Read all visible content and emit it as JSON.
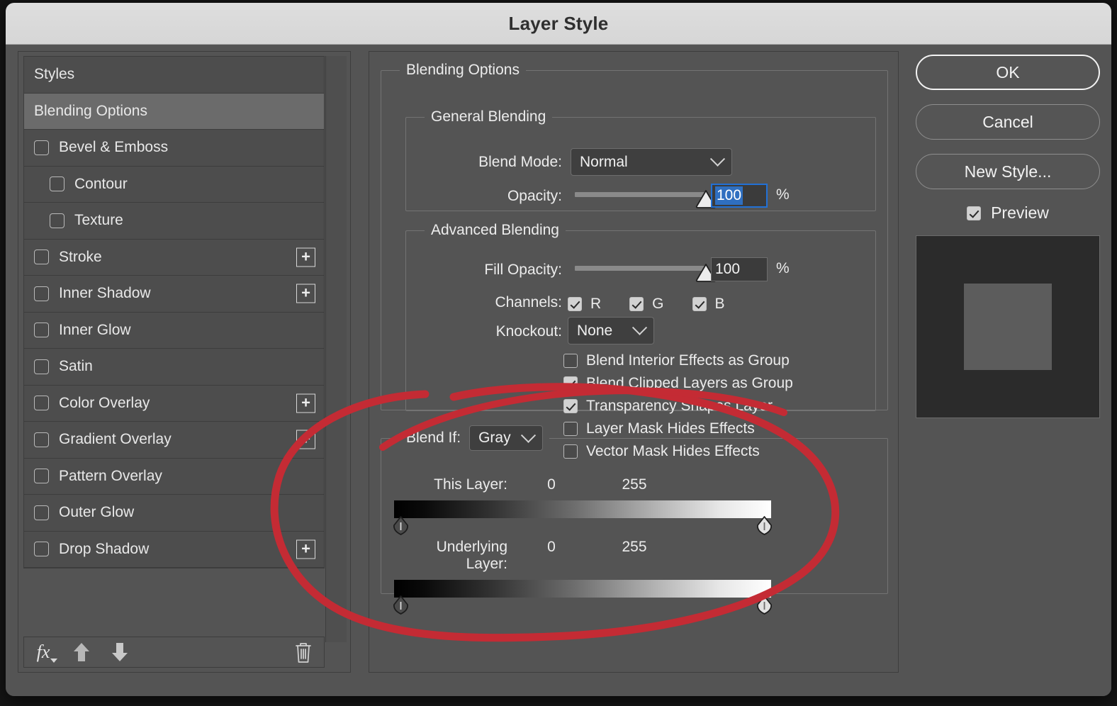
{
  "window": {
    "title": "Layer Style"
  },
  "sidebar": {
    "items": [
      {
        "label": "Styles",
        "checkbox": null,
        "indent": 0,
        "plus": false,
        "selected": false
      },
      {
        "label": "Blending Options",
        "checkbox": null,
        "indent": 0,
        "plus": false,
        "selected": true
      },
      {
        "label": "Bevel & Emboss",
        "checkbox": false,
        "indent": 0,
        "plus": false,
        "selected": false
      },
      {
        "label": "Contour",
        "checkbox": false,
        "indent": 1,
        "plus": false,
        "selected": false
      },
      {
        "label": "Texture",
        "checkbox": false,
        "indent": 1,
        "plus": false,
        "selected": false
      },
      {
        "label": "Stroke",
        "checkbox": false,
        "indent": 0,
        "plus": true,
        "selected": false
      },
      {
        "label": "Inner Shadow",
        "checkbox": false,
        "indent": 0,
        "plus": true,
        "selected": false
      },
      {
        "label": "Inner Glow",
        "checkbox": false,
        "indent": 0,
        "plus": false,
        "selected": false
      },
      {
        "label": "Satin",
        "checkbox": false,
        "indent": 0,
        "plus": false,
        "selected": false
      },
      {
        "label": "Color Overlay",
        "checkbox": false,
        "indent": 0,
        "plus": true,
        "selected": false
      },
      {
        "label": "Gradient Overlay",
        "checkbox": false,
        "indent": 0,
        "plus": true,
        "selected": false
      },
      {
        "label": "Pattern Overlay",
        "checkbox": false,
        "indent": 0,
        "plus": false,
        "selected": false
      },
      {
        "label": "Outer Glow",
        "checkbox": false,
        "indent": 0,
        "plus": false,
        "selected": false
      },
      {
        "label": "Drop Shadow",
        "checkbox": false,
        "indent": 0,
        "plus": true,
        "selected": false
      }
    ],
    "toolbar": {
      "fx_label": "fx",
      "move_up_icon": "arrow-up-icon",
      "move_down_icon": "arrow-down-icon",
      "delete_icon": "trash-icon"
    }
  },
  "main": {
    "blending_options_legend": "Blending Options",
    "general_blending": {
      "legend": "General Blending",
      "blend_mode_label": "Blend Mode:",
      "blend_mode_value": "Normal",
      "opacity_label": "Opacity:",
      "opacity_value": "100",
      "opacity_unit": "%",
      "opacity_percent": 100
    },
    "advanced_blending": {
      "legend": "Advanced Blending",
      "fill_opacity_label": "Fill Opacity:",
      "fill_opacity_value": "100",
      "fill_opacity_unit": "%",
      "fill_opacity_percent": 100,
      "channels_label": "Channels:",
      "channels": [
        {
          "label": "R",
          "checked": true
        },
        {
          "label": "G",
          "checked": true
        },
        {
          "label": "B",
          "checked": true
        }
      ],
      "knockout_label": "Knockout:",
      "knockout_value": "None",
      "options": [
        {
          "label": "Blend Interior Effects as Group",
          "checked": false
        },
        {
          "label": "Blend Clipped Layers as Group",
          "checked": true
        },
        {
          "label": "Transparency Shapes Layer",
          "checked": true
        },
        {
          "label": "Layer Mask Hides Effects",
          "checked": false
        },
        {
          "label": "Vector Mask Hides Effects",
          "checked": false
        }
      ]
    },
    "blend_if": {
      "label": "Blend If:",
      "channel_value": "Gray",
      "this_layer": {
        "label": "This Layer:",
        "black_value": "0",
        "white_value": "255"
      },
      "underlying_layer": {
        "label": "Underlying Layer:",
        "black_value": "0",
        "white_value": "255"
      }
    }
  },
  "buttons": {
    "ok": "OK",
    "cancel": "Cancel",
    "new_style": "New Style...",
    "preview_label": "Preview",
    "preview_checked": true
  },
  "annotation": {
    "shape": "ellipse",
    "color": "#c42b34",
    "target": "Blend If section"
  },
  "colors": {
    "dialog_bg": "#545454",
    "titlebar_bg": "#d8d8d8",
    "selection_blue": "#2f6fc0",
    "focus_border": "#2271d6",
    "annotation_red": "#c42b34"
  }
}
